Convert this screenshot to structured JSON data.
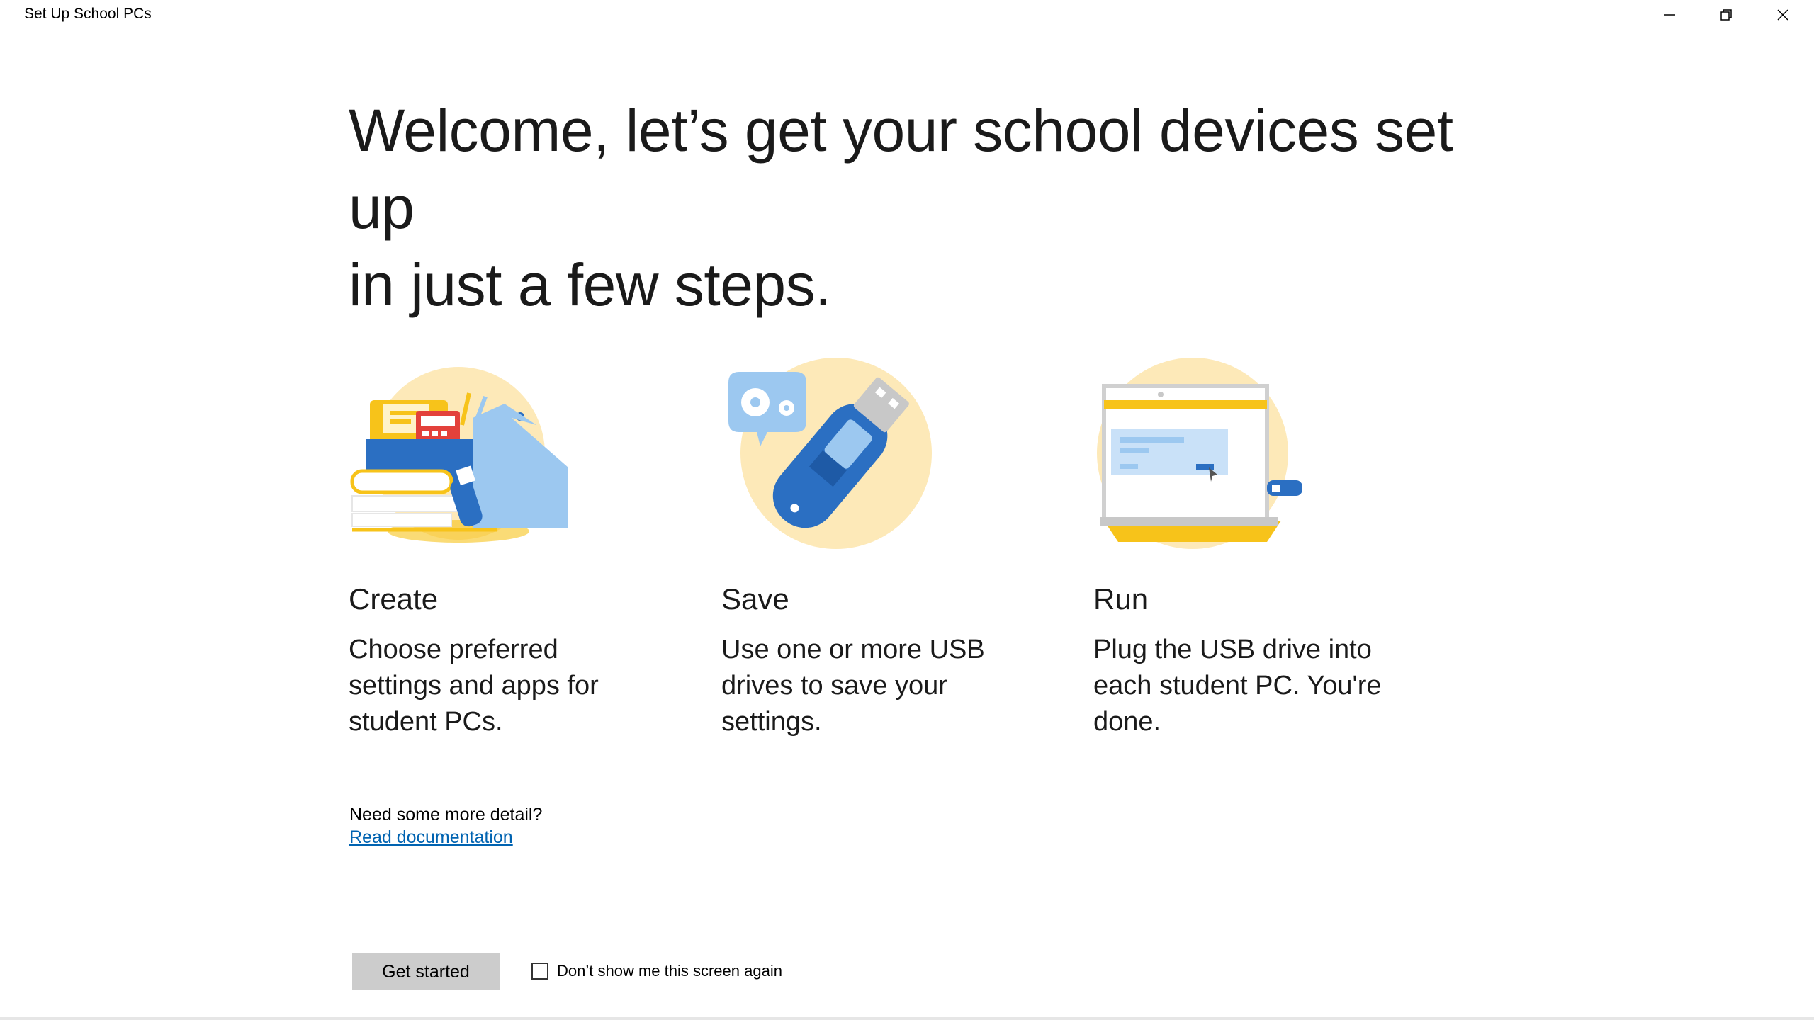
{
  "window": {
    "title": "Set Up School PCs",
    "controls": [
      "minimize-icon",
      "restore-icon",
      "close-icon"
    ]
  },
  "heading": {
    "line1": "Welcome, let’s get your school devices set up",
    "line2": "in just a few steps."
  },
  "steps": [
    {
      "title": "Create",
      "description": "Choose preferred settings and apps for student PCs.",
      "icon": "school-supplies-illustration"
    },
    {
      "title": "Save",
      "description": "Use one or more USB drives to save your settings.",
      "icon": "usb-drive-illustration"
    },
    {
      "title": "Run",
      "description": "Plug the USB drive into each student PC. You're done.",
      "icon": "laptop-usb-illustration"
    }
  ],
  "detail": {
    "prompt": "Need some more detail?",
    "link_label": "Read documentation"
  },
  "actions": {
    "primary_label": "Get started",
    "checkbox_label": "Don’t show me this screen again",
    "checkbox_checked": false
  },
  "colors": {
    "link": "#0063b1",
    "button_bg": "#cccccc",
    "illustration_circle": "#fde9b8",
    "illustration_blue": "#2b6fc2",
    "illustration_light_blue": "#9cc8f0",
    "illustration_yellow": "#f7c31a"
  }
}
